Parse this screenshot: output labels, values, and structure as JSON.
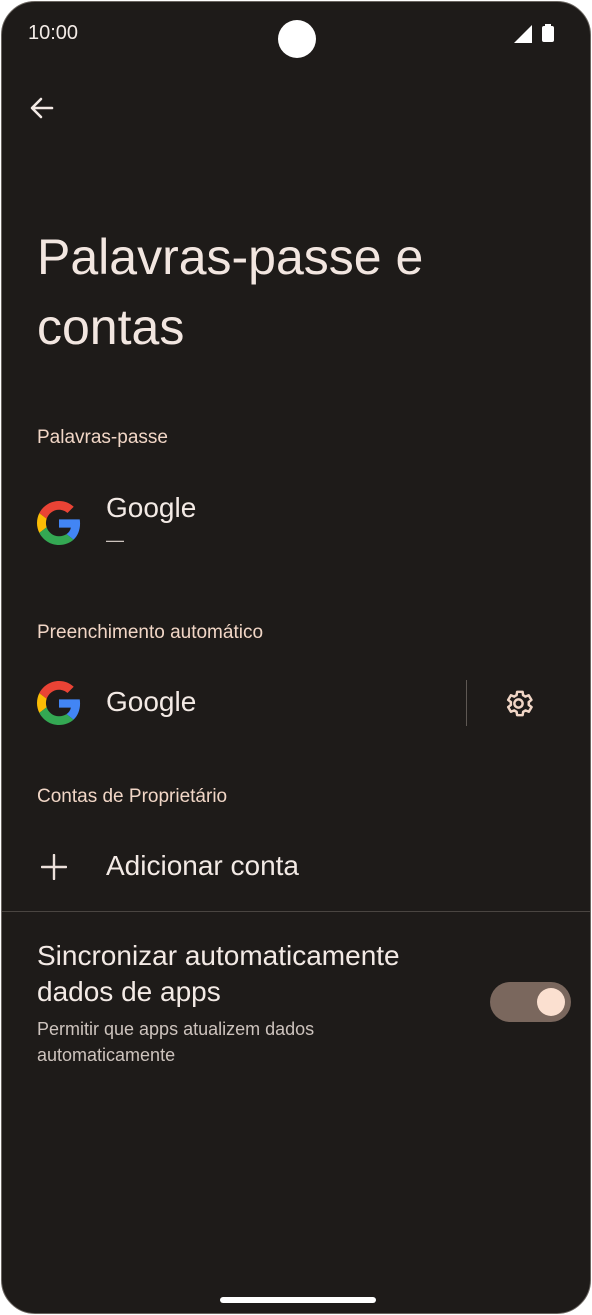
{
  "status_bar": {
    "time": "10:00"
  },
  "page": {
    "title": "Palavras-passe e contas"
  },
  "passwords_section": {
    "header": "Palavras-passe",
    "item": {
      "label": "Google",
      "sublabel": "—",
      "icon": "google-icon"
    }
  },
  "autofill_section": {
    "header": "Preenchimento automático",
    "item": {
      "label": "Google",
      "icon": "google-icon",
      "action_icon": "gear-icon"
    }
  },
  "owner_accounts_section": {
    "header": "Contas de Proprietário",
    "add_account_label": "Adicionar conta"
  },
  "sync": {
    "title": "Sincronizar automaticamente dados de apps",
    "subtitle": "Permitir que apps atualizem dados automaticamente",
    "enabled": true
  },
  "colors": {
    "background": "#1e1b19",
    "section_header": "#f1d6c6",
    "toggle_track": "#7a675d",
    "toggle_knob": "#fbe0d0"
  }
}
